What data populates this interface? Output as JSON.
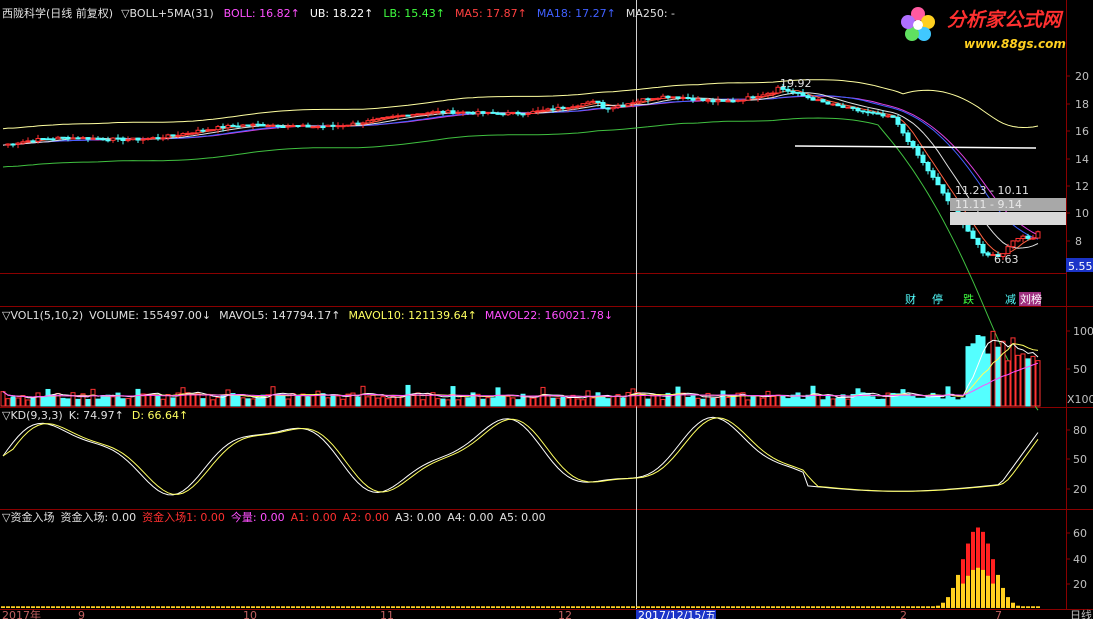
{
  "colors": {
    "bg": "#000000",
    "up": "#ff3232",
    "down": "#54ffff",
    "grid": "#b0b0b0",
    "axis": "#8a0000"
  },
  "logo": {
    "text": "分析家公式网",
    "url": "www.88gs.com"
  },
  "main": {
    "header": [
      {
        "text": "西陇科学(日线 前复权)",
        "color": "#e0e0e0"
      },
      {
        "text": "▽BOLL+5MA(31)",
        "color": "#e0e0e0"
      },
      {
        "text": "BOLL: 16.82↑",
        "color": "#ff50ff"
      },
      {
        "text": "UB: 18.22↑",
        "color": "#ffffff"
      },
      {
        "text": "LB: 15.43↑",
        "color": "#40ff40"
      },
      {
        "text": "MA5: 17.87↑",
        "color": "#ff4040"
      },
      {
        "text": "MA18: 17.27↑",
        "color": "#4060ff"
      },
      {
        "text": "MA250: -",
        "color": "#e0e0e0"
      }
    ],
    "y_ticks": [
      "20",
      "18",
      "16",
      "14",
      "12",
      "10",
      "8"
    ],
    "price_label": "5.55",
    "annotations": {
      "high": "19.92",
      "low": "6.63",
      "limit1": "11.23 - 10.11",
      "limit2": "11.11 - 9.14"
    },
    "badges": [
      "财",
      "停",
      "跌",
      "减",
      "刘榜"
    ]
  },
  "vol": {
    "header": [
      {
        "text": "▽VOL1(5,10,2)",
        "color": "#e0e0e0"
      },
      {
        "text": "VOLUME: 155497.00↓",
        "color": "#e0e0e0"
      },
      {
        "text": "MAVOL5: 147794.17↑",
        "color": "#e0e0e0"
      },
      {
        "text": "MAVOL10: 121139.64↑",
        "color": "#ffff60"
      },
      {
        "text": "MAVOL22: 160021.78↓",
        "color": "#ff50ff"
      }
    ],
    "y_ticks": [
      "100",
      "50"
    ],
    "unit": "X100"
  },
  "kd": {
    "header": [
      {
        "text": "▽KD(9,3,3)",
        "color": "#e0e0e0"
      },
      {
        "text": "K: 74.97↑",
        "color": "#e0e0e0"
      },
      {
        "text": "D: 66.64↑",
        "color": "#ffff60"
      }
    ],
    "y_ticks": [
      "80",
      "50",
      "20"
    ]
  },
  "fund": {
    "header": [
      {
        "text": "▽资金入场",
        "color": "#e0e0e0"
      },
      {
        "text": "资金入场: 0.00",
        "color": "#e0e0e0"
      },
      {
        "text": "资金入场1: 0.00",
        "color": "#ff3030"
      },
      {
        "text": "今量: 0.00",
        "color": "#ff50ff"
      },
      {
        "text": "A1: 0.00",
        "color": "#ff3030"
      },
      {
        "text": "A2: 0.00",
        "color": "#ff3030"
      },
      {
        "text": "A3: 0.00",
        "color": "#e0e0e0"
      },
      {
        "text": "A4: 0.00",
        "color": "#e0e0e0"
      },
      {
        "text": "A5: 0.00",
        "color": "#e0e0e0"
      }
    ],
    "y_ticks": [
      "60",
      "40",
      "20"
    ]
  },
  "x_axis": [
    "2017年",
    "9",
    "10",
    "11",
    "12",
    "2017/12/15/五",
    "2",
    "7",
    "日线"
  ]
}
